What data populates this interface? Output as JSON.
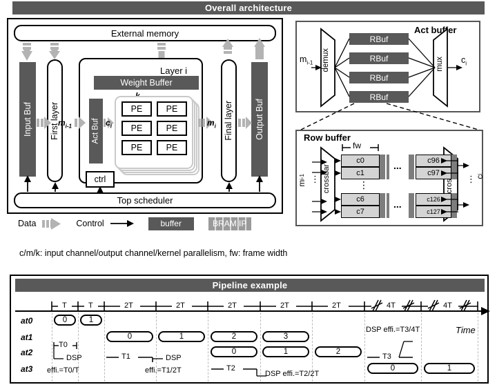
{
  "sections": {
    "overall": {
      "title": "Overall architecture"
    },
    "pipeline": {
      "title": "Pipeline example"
    }
  },
  "architecture": {
    "external_memory": "External memory",
    "top_scheduler": "Top scheduler",
    "input_buf": "Input Buf",
    "first_layer": "First layer",
    "final_layer": "Final layer",
    "output_buf": "Output Buf",
    "layer_title": "Layer i",
    "weight_buffer": "Weight Buffer",
    "act_buf": "Act Buf",
    "ctrl": "ctrl",
    "pe": "PE",
    "pe_cells": [
      "PE",
      "PE",
      "PE",
      "PE",
      "PE",
      "PE"
    ],
    "k_label": "k",
    "k_sub": "i",
    "m_in": "m",
    "m_in_sub": "i-1",
    "c_label": "c",
    "c_sub": "i",
    "m_out": "m",
    "m_out_sub": "i"
  },
  "legend": {
    "data": "Data",
    "control": "Control",
    "buffer": "buffer",
    "bram_ip": "BRAM IP",
    "caption": "c/m/k: input channel/output channel/kernel parallelism, fw: frame width"
  },
  "act_buffer": {
    "title": "Act buffer",
    "demux": "demux",
    "mux": "mux",
    "input": "m",
    "input_sub": "i-1",
    "output": "c",
    "output_sub": "i",
    "rbufs": [
      "RBuf",
      "RBuf",
      "RBuf",
      "RBuf"
    ]
  },
  "row_buffer": {
    "title": "Row buffer",
    "fw": "fw",
    "crossbar_left": "crossbar",
    "crossbar_right": "crossbar",
    "input": "m",
    "input_sub": "i-1",
    "output": "c",
    "output_sub": "i",
    "ellipsis": "...",
    "vdots": "⋮",
    "cells_left_top": [
      "c0",
      "c1"
    ],
    "cells_left_bottom": [
      "c6",
      "c7"
    ],
    "cells_right_top": [
      "c96",
      "c97"
    ],
    "cells_right_bottom": [
      "c126",
      "c127"
    ]
  },
  "pipeline": {
    "axis_label": "Time",
    "rows": [
      "at0",
      "at1",
      "at2",
      "at3"
    ],
    "tick_labels": [
      "T",
      "T",
      "2T",
      "2T",
      "2T",
      "2T",
      "2T",
      "4T",
      "4T"
    ],
    "break_ticks": [
      7,
      8
    ],
    "tasks_at0": [
      "0",
      "1"
    ],
    "tasks_at1": [
      "0",
      "1",
      "2",
      "3"
    ],
    "tasks_at2": [
      "0",
      "1",
      "2"
    ],
    "tasks_at3": [
      "0",
      "1"
    ],
    "spans": [
      "T0",
      "T1",
      "T2",
      "T3"
    ],
    "annotations": [
      "DSP effi.=T0/T",
      "DSP effi.=T1/2T",
      "DSP effi.=T2/2T",
      "DSP effi.=T3/4T"
    ],
    "ann0_line1": "DSP",
    "ann0_line2": "effi.=T0/T",
    "ann1_line1": "DSP",
    "ann1_line2": "effi.=T1/2T",
    "ann2": "DSP effi.=T2/2T",
    "ann3": "DSP effi.=T3/4T"
  },
  "colors": {
    "banner": "#595959",
    "buffer_dark": "#595959",
    "bram_gray": "#9a9a9a",
    "data_arrow": "#b3b3b3",
    "cell_fill": "#d4d4d4",
    "panel_border": "#555555"
  }
}
